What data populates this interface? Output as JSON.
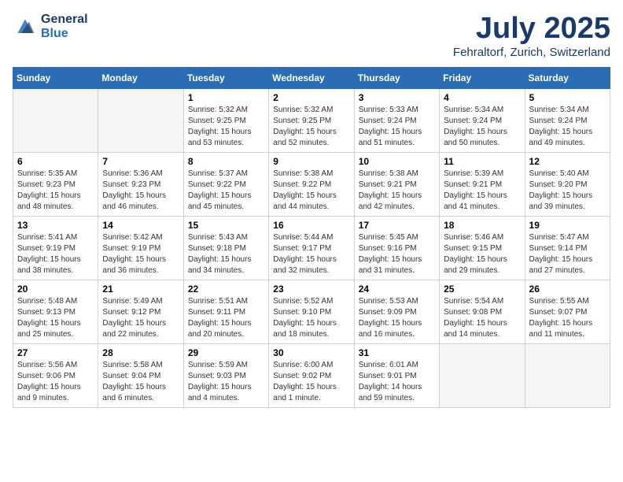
{
  "header": {
    "logo_line1": "General",
    "logo_line2": "Blue",
    "month": "July 2025",
    "location": "Fehraltorf, Zurich, Switzerland"
  },
  "weekdays": [
    "Sunday",
    "Monday",
    "Tuesday",
    "Wednesday",
    "Thursday",
    "Friday",
    "Saturday"
  ],
  "weeks": [
    [
      {
        "day": "",
        "empty": true
      },
      {
        "day": "",
        "empty": true
      },
      {
        "day": "1",
        "sunrise": "5:32 AM",
        "sunset": "9:25 PM",
        "daylight": "15 hours and 53 minutes."
      },
      {
        "day": "2",
        "sunrise": "5:32 AM",
        "sunset": "9:25 PM",
        "daylight": "15 hours and 52 minutes."
      },
      {
        "day": "3",
        "sunrise": "5:33 AM",
        "sunset": "9:24 PM",
        "daylight": "15 hours and 51 minutes."
      },
      {
        "day": "4",
        "sunrise": "5:34 AM",
        "sunset": "9:24 PM",
        "daylight": "15 hours and 50 minutes."
      },
      {
        "day": "5",
        "sunrise": "5:34 AM",
        "sunset": "9:24 PM",
        "daylight": "15 hours and 49 minutes."
      }
    ],
    [
      {
        "day": "6",
        "sunrise": "5:35 AM",
        "sunset": "9:23 PM",
        "daylight": "15 hours and 48 minutes."
      },
      {
        "day": "7",
        "sunrise": "5:36 AM",
        "sunset": "9:23 PM",
        "daylight": "15 hours and 46 minutes."
      },
      {
        "day": "8",
        "sunrise": "5:37 AM",
        "sunset": "9:22 PM",
        "daylight": "15 hours and 45 minutes."
      },
      {
        "day": "9",
        "sunrise": "5:38 AM",
        "sunset": "9:22 PM",
        "daylight": "15 hours and 44 minutes."
      },
      {
        "day": "10",
        "sunrise": "5:38 AM",
        "sunset": "9:21 PM",
        "daylight": "15 hours and 42 minutes."
      },
      {
        "day": "11",
        "sunrise": "5:39 AM",
        "sunset": "9:21 PM",
        "daylight": "15 hours and 41 minutes."
      },
      {
        "day": "12",
        "sunrise": "5:40 AM",
        "sunset": "9:20 PM",
        "daylight": "15 hours and 39 minutes."
      }
    ],
    [
      {
        "day": "13",
        "sunrise": "5:41 AM",
        "sunset": "9:19 PM",
        "daylight": "15 hours and 38 minutes."
      },
      {
        "day": "14",
        "sunrise": "5:42 AM",
        "sunset": "9:19 PM",
        "daylight": "15 hours and 36 minutes."
      },
      {
        "day": "15",
        "sunrise": "5:43 AM",
        "sunset": "9:18 PM",
        "daylight": "15 hours and 34 minutes."
      },
      {
        "day": "16",
        "sunrise": "5:44 AM",
        "sunset": "9:17 PM",
        "daylight": "15 hours and 32 minutes."
      },
      {
        "day": "17",
        "sunrise": "5:45 AM",
        "sunset": "9:16 PM",
        "daylight": "15 hours and 31 minutes."
      },
      {
        "day": "18",
        "sunrise": "5:46 AM",
        "sunset": "9:15 PM",
        "daylight": "15 hours and 29 minutes."
      },
      {
        "day": "19",
        "sunrise": "5:47 AM",
        "sunset": "9:14 PM",
        "daylight": "15 hours and 27 minutes."
      }
    ],
    [
      {
        "day": "20",
        "sunrise": "5:48 AM",
        "sunset": "9:13 PM",
        "daylight": "15 hours and 25 minutes."
      },
      {
        "day": "21",
        "sunrise": "5:49 AM",
        "sunset": "9:12 PM",
        "daylight": "15 hours and 22 minutes."
      },
      {
        "day": "22",
        "sunrise": "5:51 AM",
        "sunset": "9:11 PM",
        "daylight": "15 hours and 20 minutes."
      },
      {
        "day": "23",
        "sunrise": "5:52 AM",
        "sunset": "9:10 PM",
        "daylight": "15 hours and 18 minutes."
      },
      {
        "day": "24",
        "sunrise": "5:53 AM",
        "sunset": "9:09 PM",
        "daylight": "15 hours and 16 minutes."
      },
      {
        "day": "25",
        "sunrise": "5:54 AM",
        "sunset": "9:08 PM",
        "daylight": "15 hours and 14 minutes."
      },
      {
        "day": "26",
        "sunrise": "5:55 AM",
        "sunset": "9:07 PM",
        "daylight": "15 hours and 11 minutes."
      }
    ],
    [
      {
        "day": "27",
        "sunrise": "5:56 AM",
        "sunset": "9:06 PM",
        "daylight": "15 hours and 9 minutes."
      },
      {
        "day": "28",
        "sunrise": "5:58 AM",
        "sunset": "9:04 PM",
        "daylight": "15 hours and 6 minutes."
      },
      {
        "day": "29",
        "sunrise": "5:59 AM",
        "sunset": "9:03 PM",
        "daylight": "15 hours and 4 minutes."
      },
      {
        "day": "30",
        "sunrise": "6:00 AM",
        "sunset": "9:02 PM",
        "daylight": "15 hours and 1 minute."
      },
      {
        "day": "31",
        "sunrise": "6:01 AM",
        "sunset": "9:01 PM",
        "daylight": "14 hours and 59 minutes."
      },
      {
        "day": "",
        "empty": true
      },
      {
        "day": "",
        "empty": true
      }
    ]
  ],
  "labels": {
    "sunrise": "Sunrise:",
    "sunset": "Sunset:",
    "daylight": "Daylight:"
  }
}
